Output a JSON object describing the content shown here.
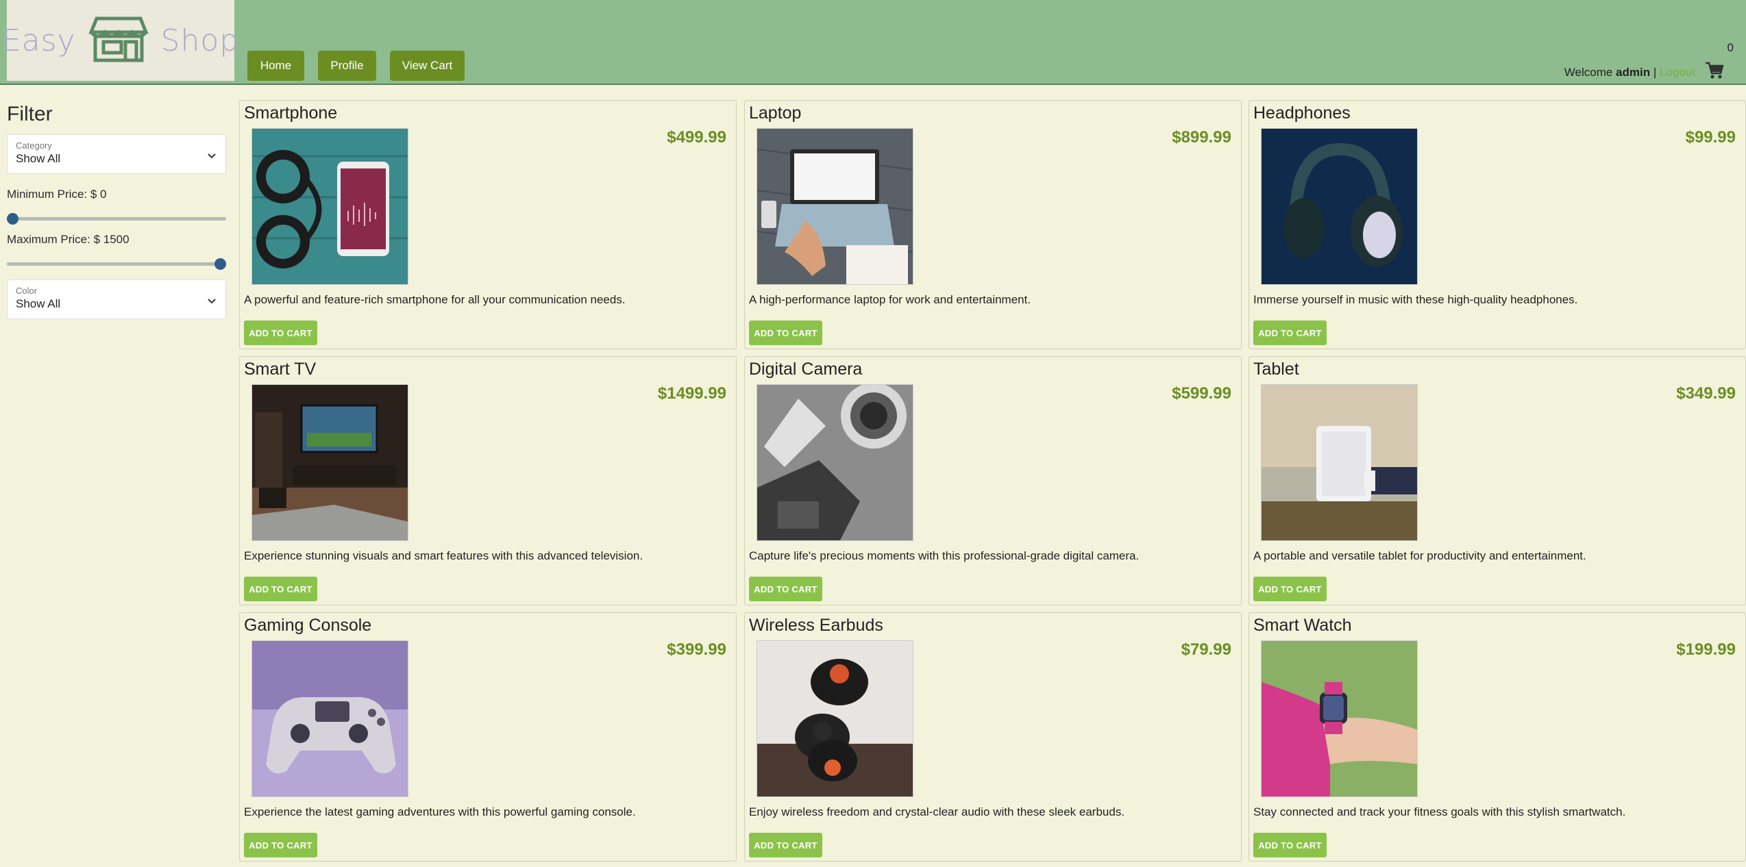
{
  "header": {
    "logo_left": "Easy",
    "logo_right": "Shop",
    "nav": [
      {
        "label": "Home"
      },
      {
        "label": "Profile"
      },
      {
        "label": "View Cart"
      }
    ],
    "cart_count": "0",
    "welcome_prefix": "Welcome",
    "username": "admin",
    "separator": "|",
    "logout_label": "Logout"
  },
  "sidebar": {
    "title": "Filter",
    "category": {
      "label": "Category",
      "value": "Show All"
    },
    "min_price_label": "Minimum Price: $ 0",
    "max_price_label": "Maximum Price: $ 1500",
    "min_price_fraction": 0,
    "max_price_fraction": 1,
    "color": {
      "label": "Color",
      "value": "Show All"
    }
  },
  "add_to_cart_label": "ADD TO CART",
  "products": [
    {
      "name": "Smartphone",
      "price": "$499.99",
      "description": "A powerful and feature-rich smartphone for all your communication needs."
    },
    {
      "name": "Laptop",
      "price": "$899.99",
      "description": "A high-performance laptop for work and entertainment."
    },
    {
      "name": "Headphones",
      "price": "$99.99",
      "description": "Immerse yourself in music with these high-quality headphones."
    },
    {
      "name": "Smart TV",
      "price": "$1499.99",
      "description": "Experience stunning visuals and smart features with this advanced television."
    },
    {
      "name": "Digital Camera",
      "price": "$599.99",
      "description": "Capture life's precious moments with this professional-grade digital camera."
    },
    {
      "name": "Tablet",
      "price": "$349.99",
      "description": "A portable and versatile tablet for productivity and entertainment."
    },
    {
      "name": "Gaming Console",
      "price": "$399.99",
      "description": "Experience the latest gaming adventures with this powerful gaming console."
    },
    {
      "name": "Wireless Earbuds",
      "price": "$79.99",
      "description": "Enjoy wireless freedom and crystal-clear audio with these sleek earbuds."
    },
    {
      "name": "Smart Watch",
      "price": "$199.99",
      "description": "Stay connected and track your fitness goals with this stylish smartwatch."
    }
  ],
  "colors": {
    "header_bg": "#8fbc8f",
    "nav_button": "#6b8e23",
    "price": "#6b8e23",
    "add_button": "#8bc34a",
    "page_bg": "#f3f3dc"
  }
}
